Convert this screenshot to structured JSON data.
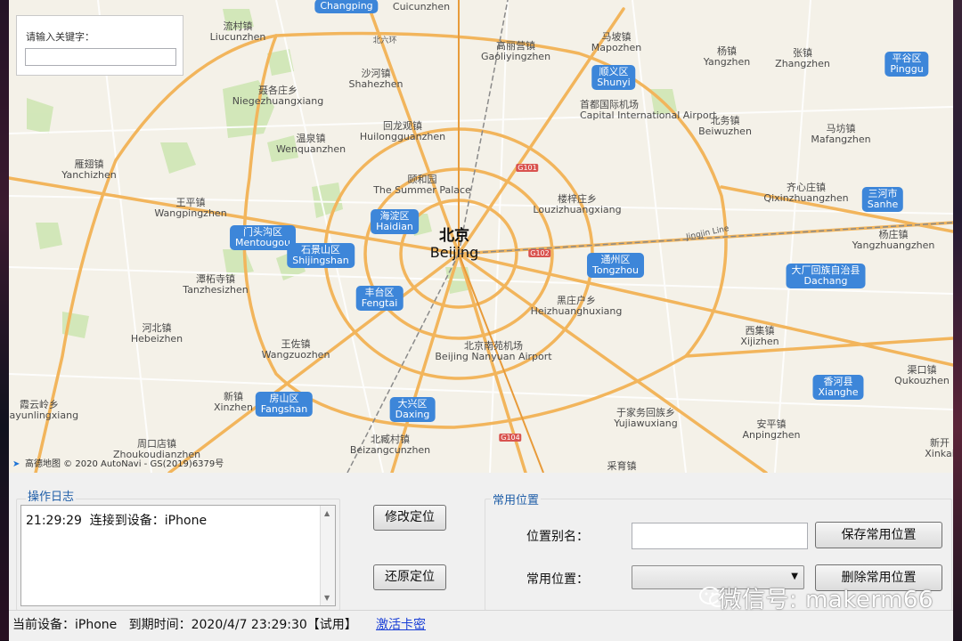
{
  "map": {
    "search_label": "请输入关键字：",
    "search_value": "",
    "copyright": "高德地图 © 2020 AutoNavi - GS(2019)6379号",
    "city": {
      "cn": "北京",
      "en": "Beijing"
    },
    "ring_label": "北六环",
    "jingjin": "Jingjin Line",
    "road_tags": [
      "G101",
      "G102",
      "G104"
    ],
    "districts": [
      {
        "cn": "Changping",
        "en": ""
      },
      {
        "cn": "顺义区",
        "en": "Shunyi"
      },
      {
        "cn": "平谷区",
        "en": "Pinggu"
      },
      {
        "cn": "海淀区",
        "en": "Haidian"
      },
      {
        "cn": "门头沟区",
        "en": "Mentougou"
      },
      {
        "cn": "石景山区",
        "en": "Shijingshan"
      },
      {
        "cn": "丰台区",
        "en": "Fengtai"
      },
      {
        "cn": "通州区",
        "en": "Tongzhou"
      },
      {
        "cn": "三河市",
        "en": "Sanhe"
      },
      {
        "cn": "大厂回族自治县",
        "en": "Dachang"
      },
      {
        "cn": "房山区",
        "en": "Fangshan"
      },
      {
        "cn": "大兴区",
        "en": "Daxing"
      },
      {
        "cn": "香河县",
        "en": "Xianghe"
      }
    ],
    "places": [
      {
        "cn": "",
        "en": "Cuicunzhen"
      },
      {
        "cn": "流村镇",
        "en": "Liucunzhen"
      },
      {
        "cn": "高丽营镇",
        "en": "Gaoliyingzhen"
      },
      {
        "cn": "马坡镇",
        "en": "Mapozhen"
      },
      {
        "cn": "杨镇",
        "en": "Yangzhen"
      },
      {
        "cn": "张镇",
        "en": "Zhangzhen"
      },
      {
        "cn": "沙河镇",
        "en": "Shahezhen"
      },
      {
        "cn": "聂各庄乡",
        "en": "Niegezhuangxiang"
      },
      {
        "cn": "首都国际机场",
        "en": "Capital International Airport"
      },
      {
        "cn": "北务镇",
        "en": "Beiwuzhen"
      },
      {
        "cn": "马坊镇",
        "en": "Mafangzhen"
      },
      {
        "cn": "回龙观镇",
        "en": "Huilongguanzhen"
      },
      {
        "cn": "温泉镇",
        "en": "Wenquanzhen"
      },
      {
        "cn": "雁翅镇",
        "en": "Yanchizhen"
      },
      {
        "cn": "颐和园",
        "en": "The Summer Palace"
      },
      {
        "cn": "王平镇",
        "en": "Wangpingzhen"
      },
      {
        "cn": "楼梓庄乡",
        "en": "Louzizhuangxiang"
      },
      {
        "cn": "齐心庄镇",
        "en": "Qixinzhuangzhen"
      },
      {
        "cn": "杨庄镇",
        "en": "Yangzhuangzhen"
      },
      {
        "cn": "潭柘寺镇",
        "en": "Tanzhesizhen"
      },
      {
        "cn": "黑庄户乡",
        "en": "Heizhuanghuxiang"
      },
      {
        "cn": "河北镇",
        "en": "Hebeizhen"
      },
      {
        "cn": "王佐镇",
        "en": "Wangzuozhen"
      },
      {
        "cn": "北京南苑机场",
        "en": "Beijing Nanyuan Airport"
      },
      {
        "cn": "西集镇",
        "en": "Xijizhen"
      },
      {
        "cn": "新镇",
        "en": "Xinzhen"
      },
      {
        "cn": "霞云岭乡",
        "en": "Xiayunlingxiang"
      },
      {
        "cn": "于家务回族乡",
        "en": "Yujiawuxiang"
      },
      {
        "cn": "渠口镇",
        "en": "Qukouzhen"
      },
      {
        "cn": "安平镇",
        "en": "Anpingzhen"
      },
      {
        "cn": "周口店镇",
        "en": "Zhoukoudianzhen"
      },
      {
        "cn": "北臧村镇",
        "en": "Beizangcunzhen"
      },
      {
        "cn": "新开",
        "en": "Xinkai"
      },
      {
        "cn": "采育镇",
        "en": ""
      }
    ]
  },
  "log": {
    "title": "操作日志",
    "entries": [
      {
        "time": "21:29:29",
        "text": "连接到设备：iPhone"
      }
    ]
  },
  "actions": {
    "modify": "修改定位",
    "restore": "还原定位"
  },
  "favorites": {
    "title": "常用位置",
    "alias_label": "位置别名：",
    "alias_value": "",
    "fav_label": "常用位置：",
    "fav_selected": "",
    "save_button": "保存常用位置",
    "delete_button": "删除常用位置"
  },
  "status": {
    "text": "当前设备：iPhone   到期时间：2020/4/7 23:29:30【试用】",
    "activate": "激活卡密"
  },
  "watermark": "微信号: makerm66",
  "colors": {
    "district_badge": "#3d86d9",
    "link": "#1a3fd6",
    "group_title": "#1f5ea8",
    "road": "#f2b55c"
  }
}
